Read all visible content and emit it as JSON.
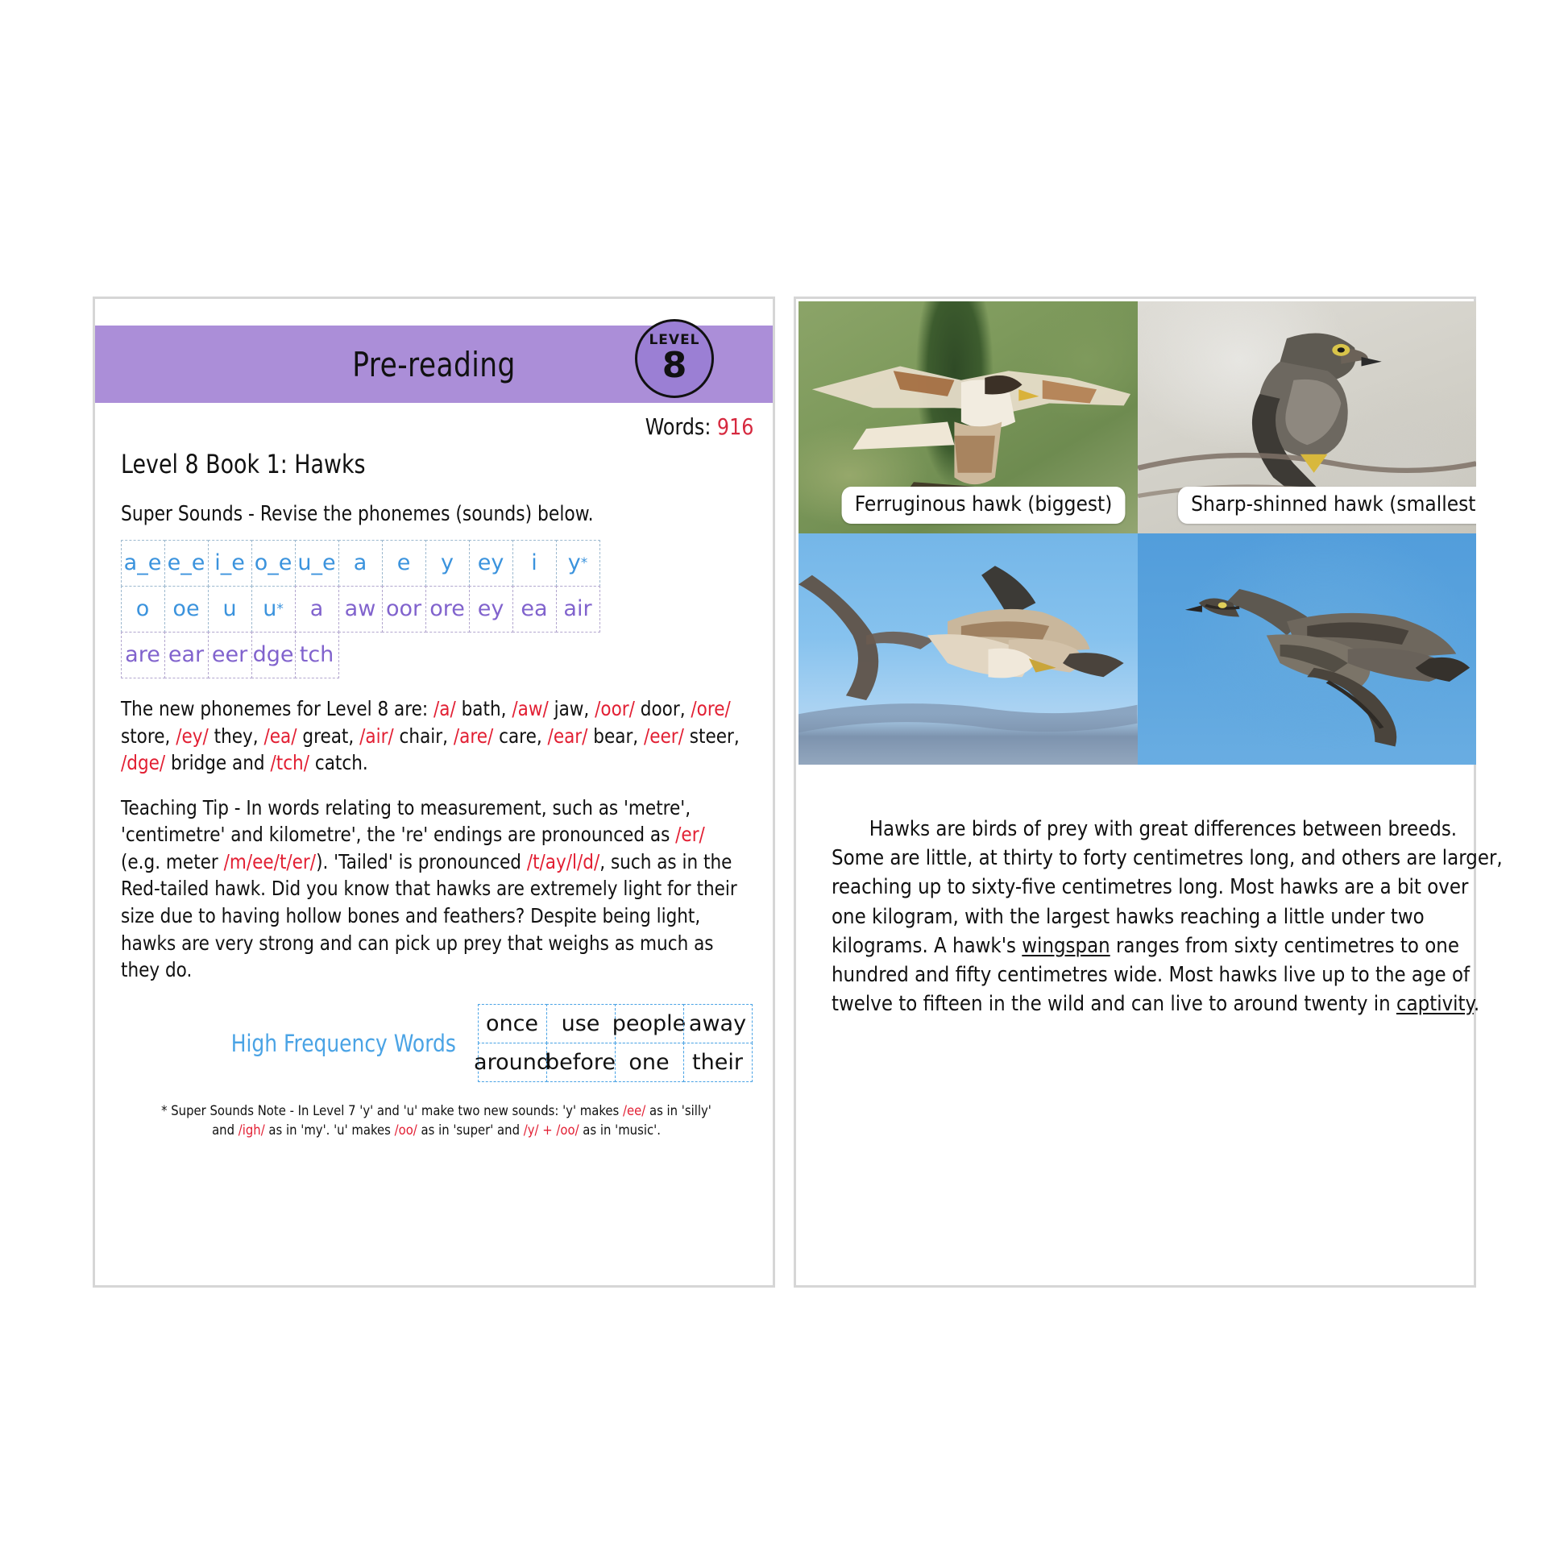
{
  "left_page": {
    "title": "Pre-reading",
    "level_badge": {
      "word": "LEVEL",
      "number": "8"
    },
    "words_label": "Words:",
    "words_count": "916",
    "book_title": "Level 8 Book 1: Hawks",
    "super_sounds_instruction": "Super Sounds - Revise the phonemes (sounds) below.",
    "phoneme_rows": [
      [
        {
          "text": "a_e",
          "color": "blue"
        },
        {
          "text": "e_e",
          "color": "blue"
        },
        {
          "text": "i_e",
          "color": "blue"
        },
        {
          "text": "o_e",
          "color": "blue"
        },
        {
          "text": "u_e",
          "color": "blue"
        },
        {
          "text": "a",
          "color": "blue"
        },
        {
          "text": "e",
          "color": "blue"
        },
        {
          "text": "y",
          "color": "blue"
        },
        {
          "text": "ey",
          "color": "blue"
        },
        {
          "text": "i",
          "color": "blue"
        },
        {
          "text": "y",
          "color": "blue",
          "star": true
        }
      ],
      [
        {
          "text": "o",
          "color": "blue"
        },
        {
          "text": "oe",
          "color": "blue"
        },
        {
          "text": "u",
          "color": "blue"
        },
        {
          "text": "u",
          "color": "blue",
          "star": true
        },
        {
          "text": "a",
          "color": "purple"
        },
        {
          "text": "aw",
          "color": "purple"
        },
        {
          "text": "oor",
          "color": "purple"
        },
        {
          "text": "ore",
          "color": "purple"
        },
        {
          "text": "ey",
          "color": "purple"
        },
        {
          "text": "ea",
          "color": "purple"
        },
        {
          "text": "air",
          "color": "purple"
        }
      ],
      [
        {
          "text": "are",
          "color": "purple"
        },
        {
          "text": "ear",
          "color": "purple"
        },
        {
          "text": "eer",
          "color": "purple"
        },
        {
          "text": "dge",
          "color": "purple"
        },
        {
          "text": "tch",
          "color": "purple"
        }
      ]
    ],
    "new_phonemes_paragraph_html": "The new phonemes for Level 8 are: <span class=\"ph\">/a/</span> bath, <span class=\"ph\">/aw/</span> jaw, <span class=\"ph\">/oor/</span> door, <span class=\"ph\">/ore/</span> store, <span class=\"ph\">/ey/</span> they, <span class=\"ph\">/ea/</span> great, <span class=\"ph\">/air/</span> chair, <span class=\"ph\">/are/</span> care, <span class=\"ph\">/ear/</span> bear, <span class=\"ph\">/eer/</span> steer, <span class=\"ph\">/dge/</span> bridge and <span class=\"ph\">/tch/</span> catch.",
    "teaching_tip_paragraph_html": "Teaching Tip - In words relating to measurement, such as 'metre', 'centimetre' and kilometre', the 're' endings are pronounced as <span class=\"ph\">/er/</span> (e.g. meter <span class=\"ph\">/m/ee/t/er/</span>). 'Tailed' is pronounced <span class=\"ph\">/t/ay/l/d/</span>, such as in the Red-tailed hawk. Did you know that hawks are extremely light for their size due to having hollow bones and feathers? Despite being light, hawks are very strong and can pick up prey that weighs as much as they do.",
    "high_frequency_label": "High Frequency Words",
    "high_frequency_words": [
      [
        "once",
        "use",
        "people",
        "away"
      ],
      [
        "around",
        "before",
        "one",
        "their"
      ]
    ],
    "footnote_html": "* Super Sounds Note - In Level 7 'y' and 'u' make two new sounds:  'y'  makes <span class=\"ph\">/ee/</span> as in 'silly' and <span class=\"ph\">/igh/</span> as in 'my'. 'u' makes <span class=\"ph\">/oo/</span> as in 'super' and <span class=\"ph\">/y/ + /oo/</span> as in 'music'."
  },
  "right_page": {
    "photos": [
      {
        "name": "ferruginous-hawk-perched",
        "caption": "Ferruginous hawk (biggest)"
      },
      {
        "name": "sharp-shinned-hawk-on-wire",
        "caption": "Sharp-shinned hawk (smallest)"
      },
      {
        "name": "hawk-in-flight-by-branch",
        "caption": ""
      },
      {
        "name": "hawk-soaring-blue-sky",
        "caption": ""
      }
    ],
    "body_html": "<span class=\"indent\"></span>Hawks are birds of prey with great differences between breeds. Some are little, at thirty to forty centimetres long, and others are larger, reaching up to sixty-five centimetres long. Most hawks are a bit over one kilogram, with the largest hawks reaching a little under two kilograms. A hawk's <u>wingspan</u> ranges from sixty centimetres to one hundred and fifty centimetres wide. Most hawks live up to the age of twelve to fifteen in the wild and can live to around twenty in <u>captivity</u>."
  },
  "colors": {
    "band_purple": "#ab8ed8",
    "badge_purple": "#9b7fd4",
    "phoneme_blue": "#3b93dd",
    "phoneme_purple": "#8163cd",
    "red_accent": "#e21f33",
    "hfw_blue": "#4aa3e5"
  }
}
